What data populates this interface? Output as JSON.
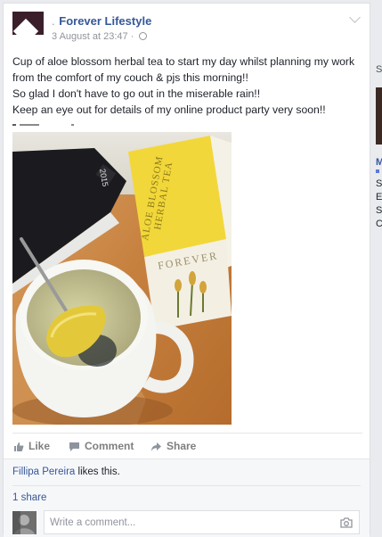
{
  "post": {
    "author": {
      "prefix": ".",
      "name": "Forever Lifestyle"
    },
    "timestamp": "3 August at 23:47",
    "separator": "·",
    "text_lines": [
      "Cup of aloe blossom herbal tea to start my day whilst planning my work",
      "from the comfort of my couch & pjs this morning!!",
      "So glad I don't have to go out in the miserable rain!!",
      "Keep an eye out for details of my online product party very soon!!"
    ],
    "photo": {
      "box_text_1": "ALOE BLOSSOM",
      "box_text_2": "HERBAL TEA",
      "box_brand": "FOREVER",
      "book_label": "2015"
    }
  },
  "actions": {
    "like": "Like",
    "comment": "Comment",
    "share": "Share"
  },
  "social": {
    "liker": "Fillipa Pereira",
    "likes_suffix": " likes this.",
    "shares": "1 share",
    "comment_placeholder": "Write a comment..."
  },
  "sidebar": {
    "letters": [
      "S",
      "M",
      "S",
      "E",
      "S",
      "C"
    ]
  },
  "colors": {
    "link": "#365899",
    "text": "#1d2129",
    "muted": "#90949c",
    "background": "#e9ebee"
  }
}
